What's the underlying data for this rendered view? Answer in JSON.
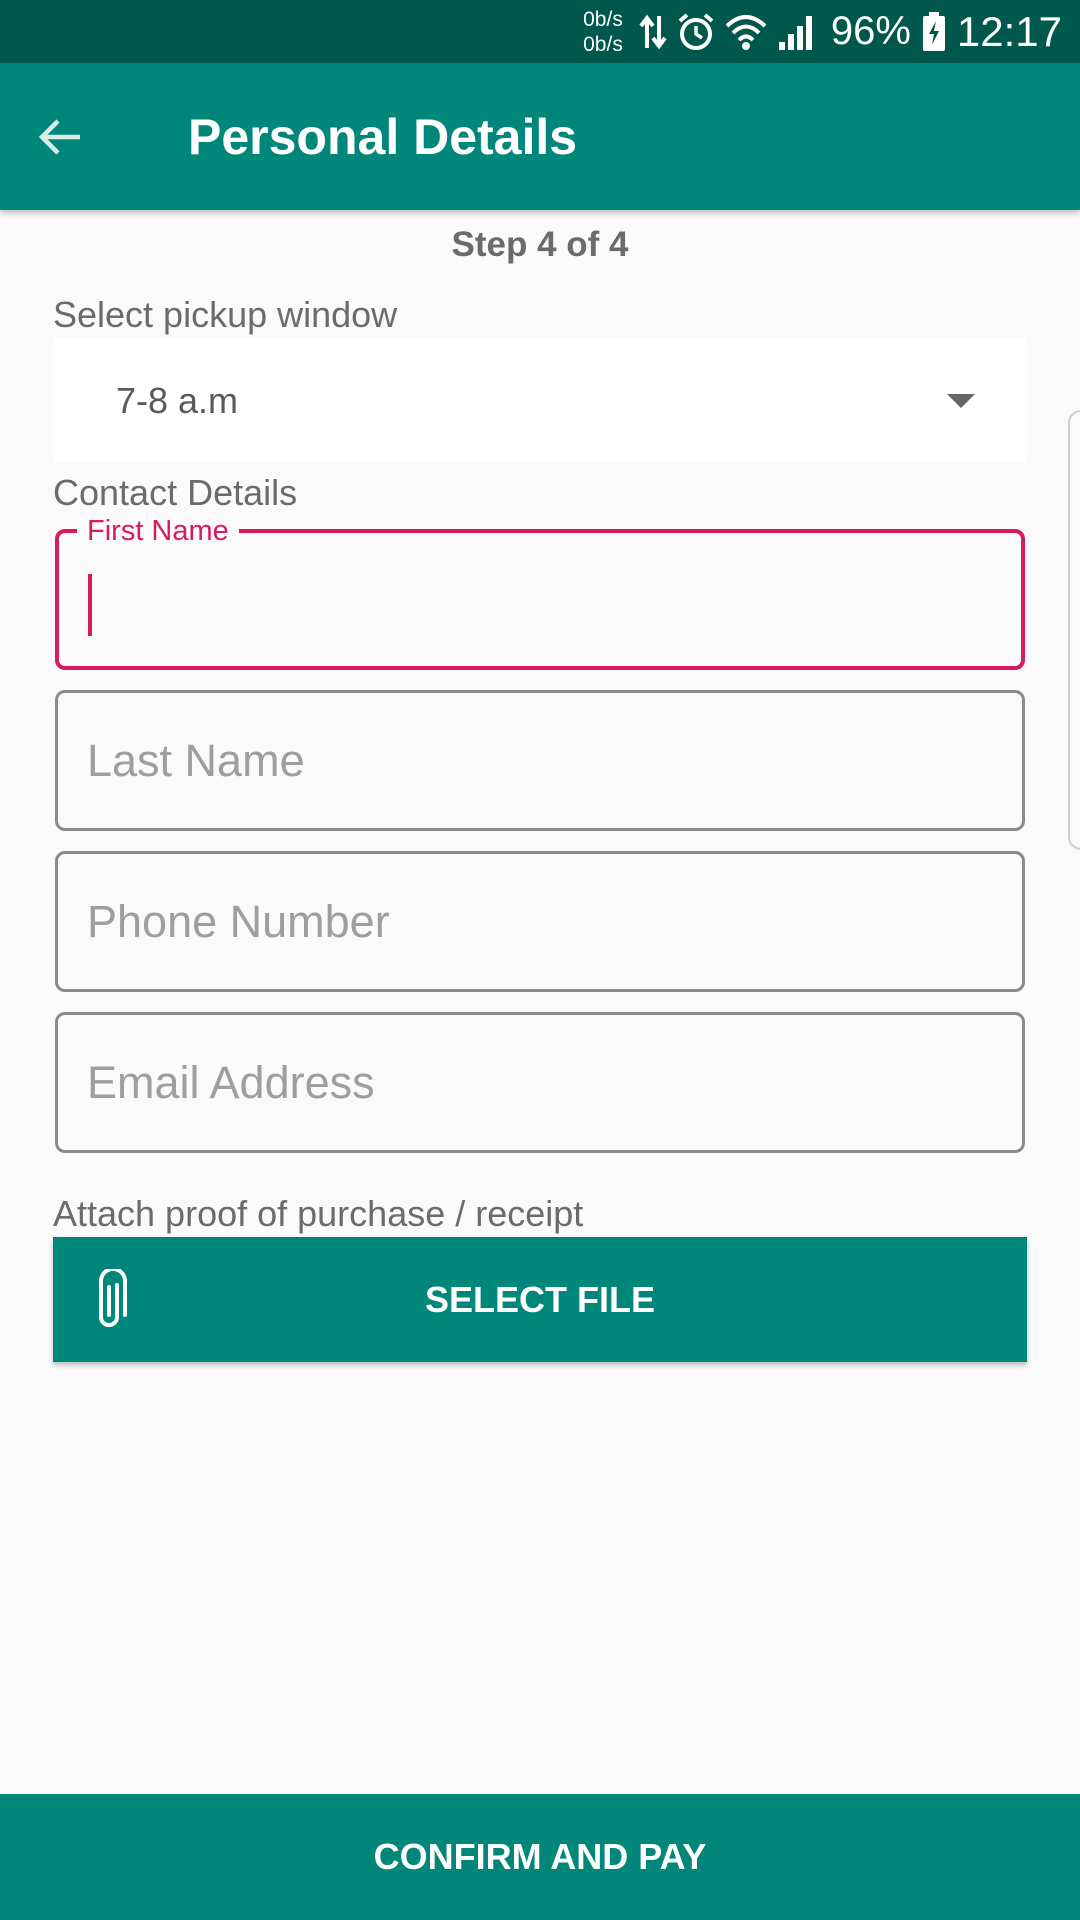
{
  "status_bar": {
    "net_up": "0b/s",
    "net_down": "0b/s",
    "icons": [
      "data-transfer-icon",
      "alarm-icon",
      "wifi-icon",
      "signal-icon",
      "battery-charging-icon"
    ],
    "battery": "96%",
    "time": "12:17"
  },
  "app_bar": {
    "back_icon": "arrow-back-icon",
    "title": "Personal Details"
  },
  "form": {
    "step": "Step 4 of 4",
    "pickup_label": "Select pickup window",
    "pickup_value": "7-8 a.m",
    "contact_label": "Contact Details",
    "first_name_label": "First Name",
    "first_name_value": "",
    "last_name_placeholder": "Last Name",
    "phone_placeholder": "Phone Number",
    "email_placeholder": "Email Address",
    "attach_label": "Attach proof of purchase / receipt",
    "select_file_label": "SELECT FILE",
    "attach_icon": "paperclip-icon"
  },
  "footer": {
    "confirm_label": "CONFIRM AND PAY"
  },
  "colors": {
    "primary": "#00877a",
    "primary_dark": "#00574b",
    "accent": "#d81b60"
  }
}
